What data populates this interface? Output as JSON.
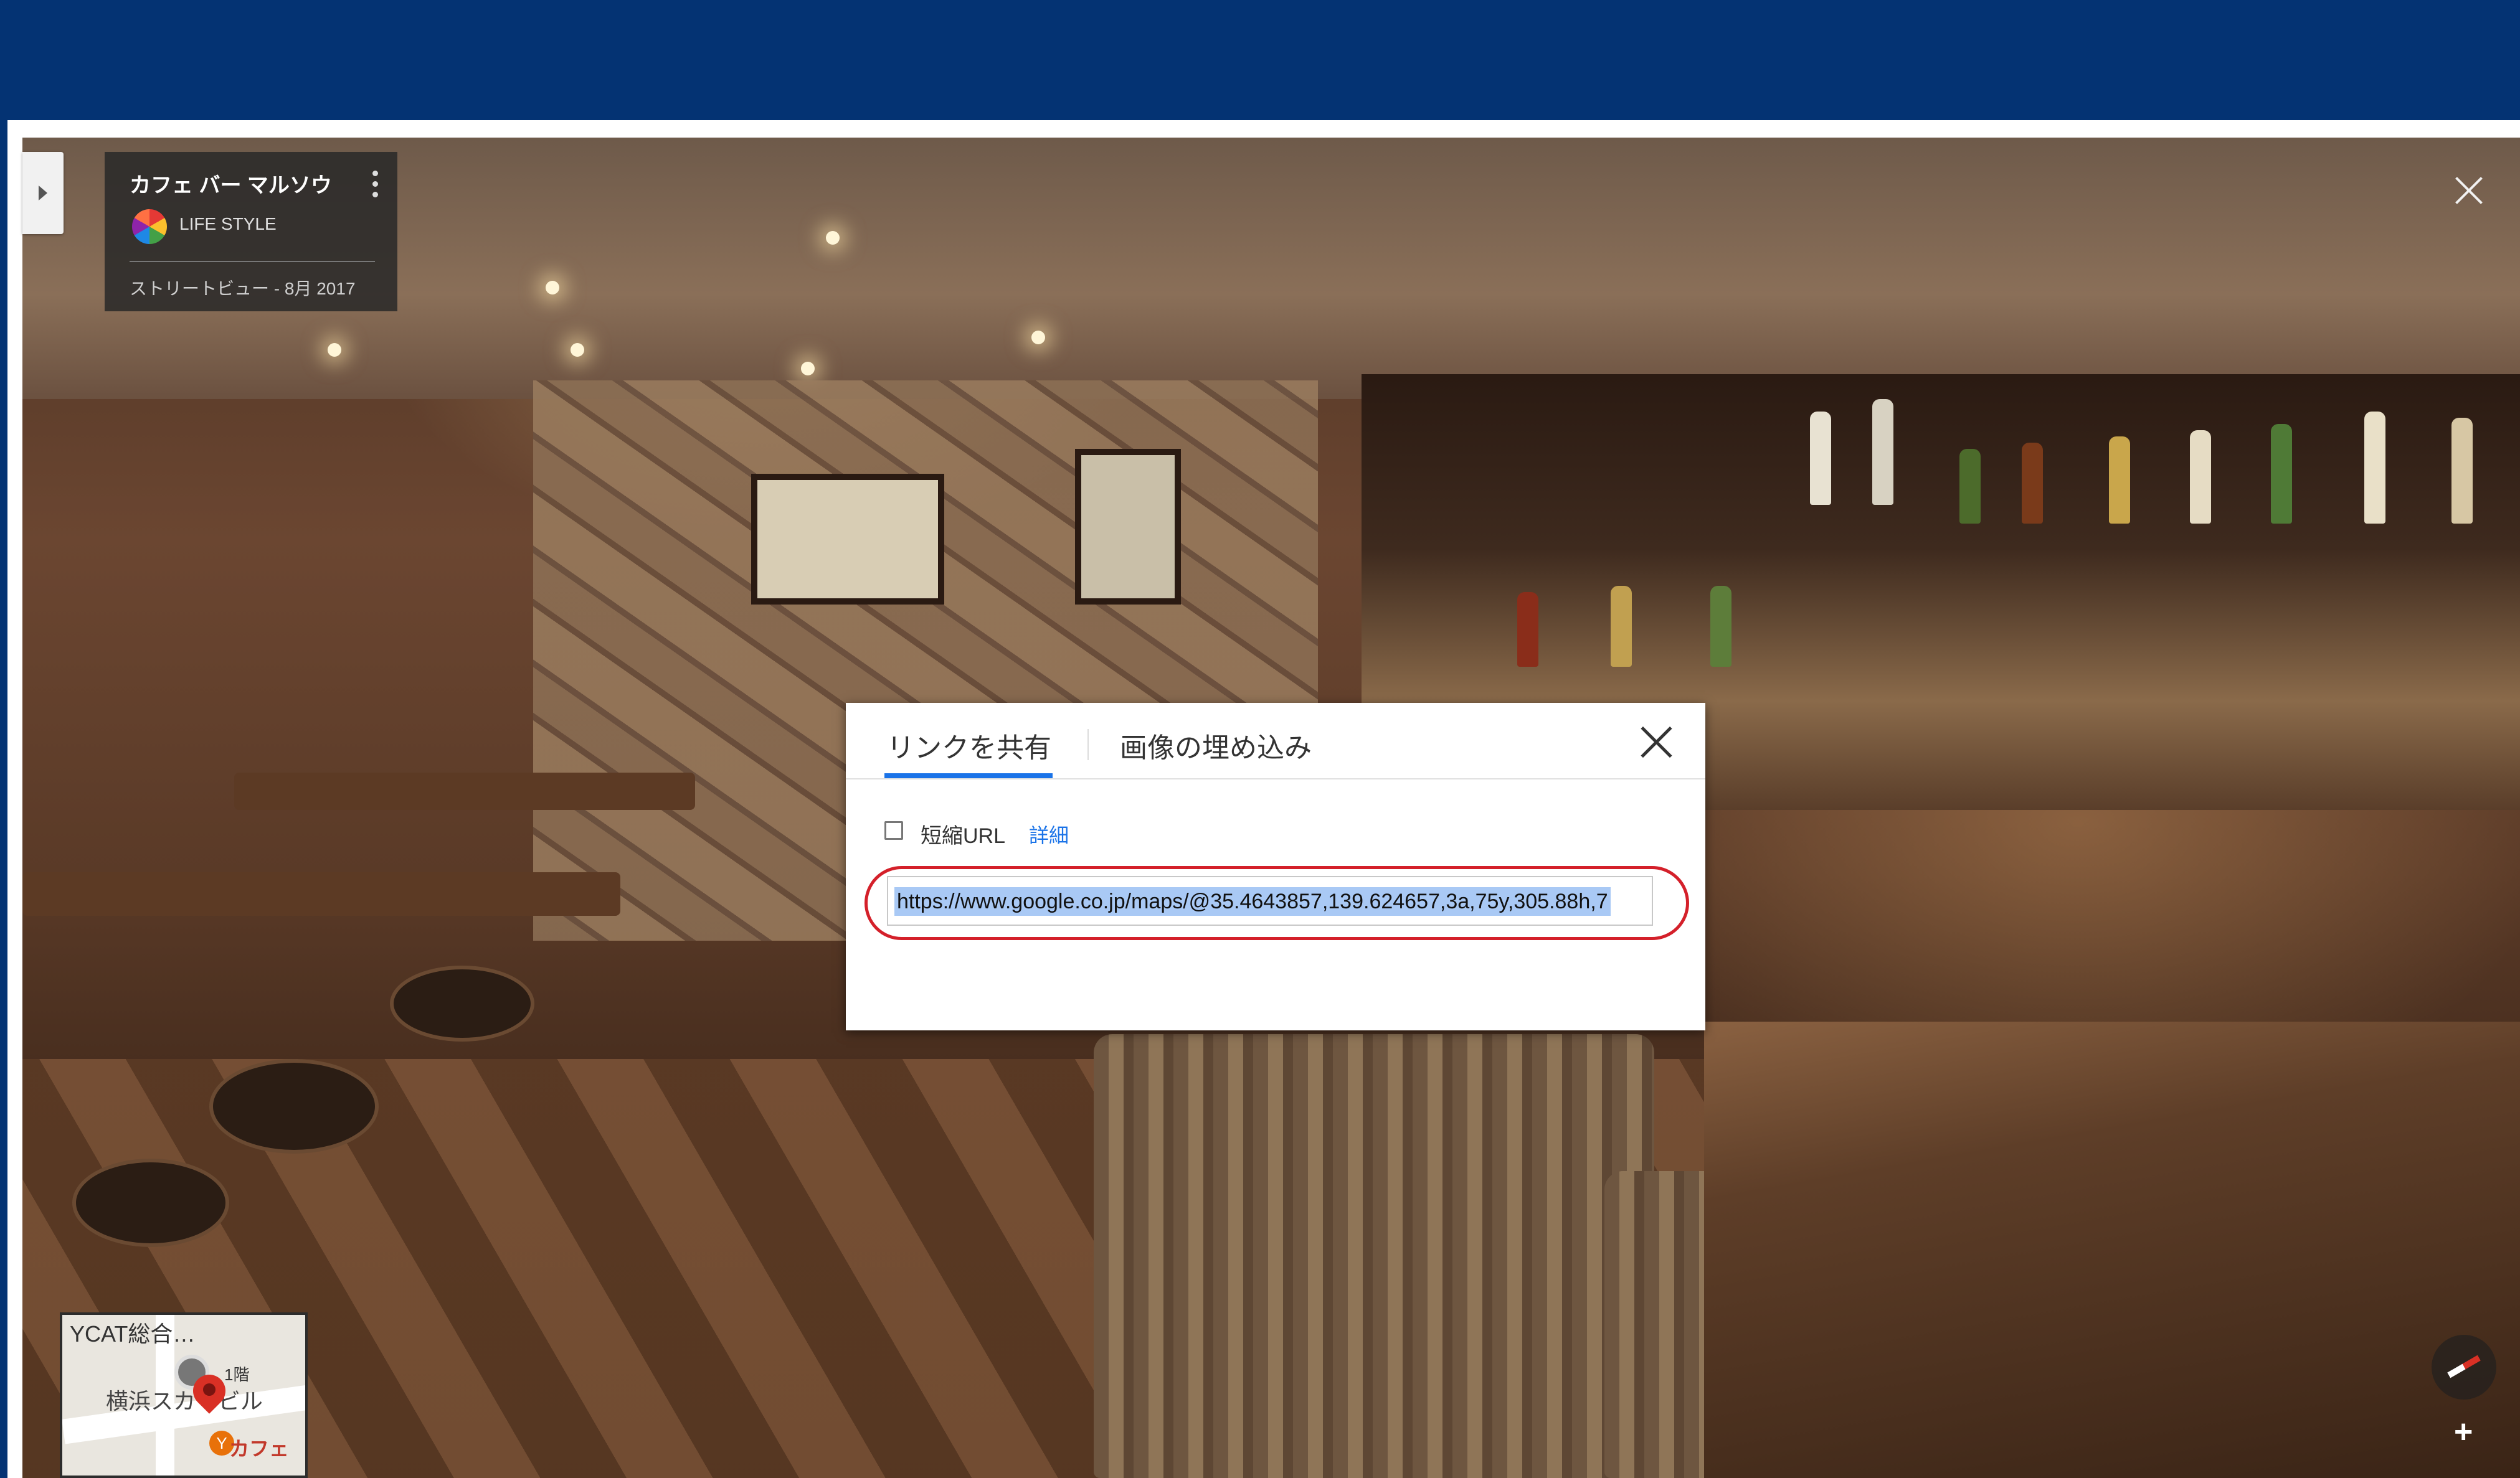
{
  "place_card": {
    "title": "カフェ バー マルソウ",
    "brand": "LIFE STYLE",
    "date": "ストリートビュー - 8月 2017",
    "menu_icon": "more-vert-icon",
    "logo_icon": "brand-logo-icon"
  },
  "dialog": {
    "tabs": [
      {
        "label": "リンクを共有",
        "active": true
      },
      {
        "label": "画像の埋め込み",
        "active": false
      }
    ],
    "short_url_label": "短縮URL",
    "short_url_checked": false,
    "details_link": "詳細",
    "url_value": "https://www.google.co.jp/maps/@35.4643857,139.624657,3a,75y,305.88h,7",
    "close_icon": "close-icon"
  },
  "minimap": {
    "label_top": "YCAT総合…",
    "floor": "1階",
    "building": "横浜スカイビル",
    "place": "カフェ",
    "cafe_glyph": "Y"
  },
  "controls": {
    "zoom_in": "+",
    "viewer_close_icon": "close-icon",
    "compass_icon": "compass-icon",
    "panel_toggle_icon": "caret-right-icon"
  },
  "colors": {
    "header_bg": "#043373",
    "link": "#1a73e8",
    "highlight_ring": "#d4202a",
    "selection": "#a9c9f5"
  }
}
